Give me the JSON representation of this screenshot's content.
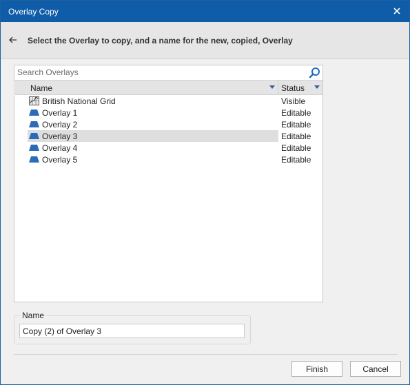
{
  "window": {
    "title": "Overlay Copy"
  },
  "header": {
    "instruction": "Select the Overlay to copy, and a name for the new, copied, Overlay"
  },
  "search": {
    "placeholder": "Search Overlays"
  },
  "columns": {
    "name": "Name",
    "status": "Status"
  },
  "overlays": [
    {
      "name": "British National Grid",
      "status": "Visible",
      "icon": "grid-map-icon"
    },
    {
      "name": "Overlay 1",
      "status": "Editable",
      "icon": "overlay-layer-icon"
    },
    {
      "name": "Overlay 2",
      "status": "Editable",
      "icon": "overlay-layer-icon"
    },
    {
      "name": "Overlay 3",
      "status": "Editable",
      "icon": "overlay-layer-icon",
      "selected": true
    },
    {
      "name": "Overlay 4",
      "status": "Editable",
      "icon": "overlay-layer-icon"
    },
    {
      "name": "Overlay 5",
      "status": "Editable",
      "icon": "overlay-layer-icon"
    }
  ],
  "name_group": {
    "legend": "Name",
    "value": "Copy (2) of Overlay 3"
  },
  "buttons": {
    "finish": "Finish",
    "cancel": "Cancel"
  },
  "colors": {
    "titlebar": "#0f5da8",
    "overlay_icon": "#2b6cb8",
    "search_icon": "#1e6ac2"
  }
}
